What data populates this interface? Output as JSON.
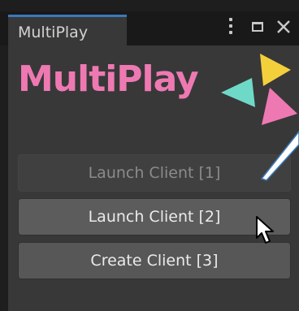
{
  "window": {
    "tab_title": "MultiPlay",
    "controls": {
      "menu_icon": "kebab-menu-icon",
      "maximize_icon": "maximize-icon",
      "close_icon": "close-icon"
    }
  },
  "logo": {
    "text": "MultiPlay",
    "color": "#ee79b2",
    "shapes": [
      "yellow-triangle",
      "teal-triangle",
      "pink-triangle"
    ],
    "colors": {
      "yellow": "#f3cf3c",
      "teal": "#6fd9c8",
      "pink": "#ee79b2"
    }
  },
  "buttons": [
    {
      "label": "Launch Client [1]",
      "state": "disabled"
    },
    {
      "label": "Launch Client [2]",
      "state": "hover"
    },
    {
      "label": "Create Client [3]",
      "state": "normal"
    }
  ],
  "accent": "#3a79bb"
}
